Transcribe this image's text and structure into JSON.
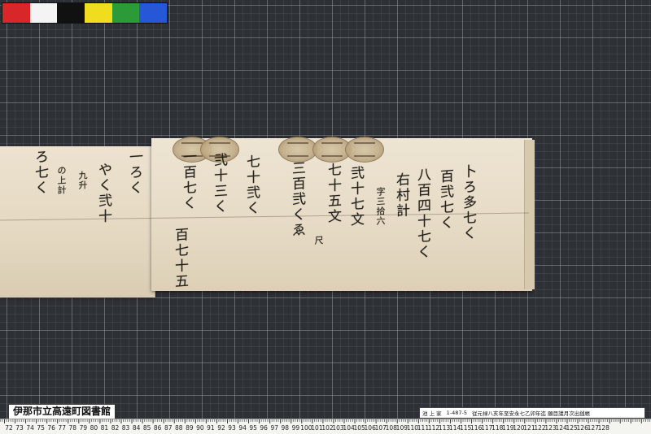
{
  "color_chart": {
    "swatches": [
      "#d8262b",
      "#f4f4f4",
      "#111111",
      "#f1dd1f",
      "#2b9b3a",
      "#2557d6"
    ]
  },
  "library_label": "伊那市立高遠町図書館",
  "catalog_label": {
    "owner": "池 上 家",
    "number": "1-487-5",
    "title": "従元禄八亥年至安永七乙卯年迄 願目議月次出銭帳"
  },
  "ruler": {
    "numbers": [
      "72",
      "73",
      "74",
      "75",
      "76",
      "77",
      "78",
      "79",
      "80",
      "81",
      "82",
      "83",
      "84",
      "85",
      "86",
      "87",
      "88",
      "89",
      "90",
      "91",
      "92",
      "93",
      "94",
      "95",
      "96",
      "97",
      "98",
      "99",
      "100",
      "101",
      "102",
      "103",
      "104",
      "105",
      "106",
      "107",
      "108",
      "109",
      "110",
      "111",
      "112",
      "113",
      "114",
      "115",
      "116",
      "117",
      "118",
      "119",
      "120",
      "121",
      "122",
      "123",
      "124",
      "125",
      "126",
      "127",
      "128"
    ]
  },
  "document": {
    "columns": [
      "卜ろ多七く",
      "百弐七く",
      "八百四十七く",
      "右村計",
      "字三拾六",
      "弐十七文",
      "七十五文",
      "尺",
      "三百弐くゑ",
      "七十弐く",
      "弐十三く",
      "一百七く",
      "百七十五",
      "一ろく",
      "やく弐十",
      "九升",
      "の上計",
      "ろ七く"
    ]
  }
}
